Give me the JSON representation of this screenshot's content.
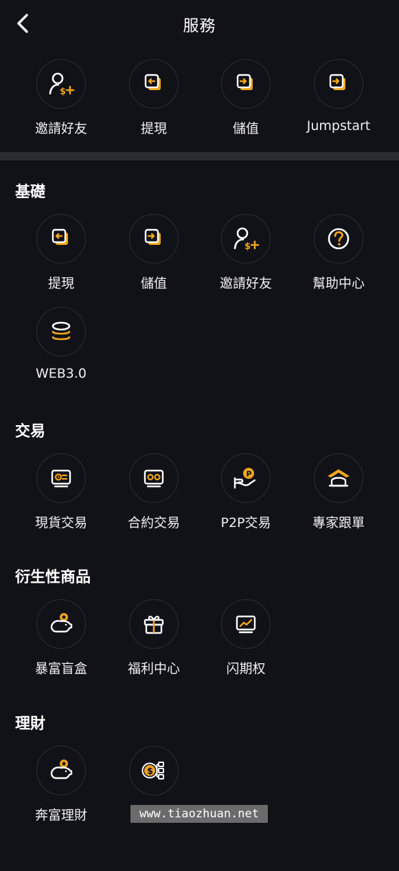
{
  "header": {
    "title": "服務",
    "back_icon": "chevron-left-icon"
  },
  "colors": {
    "background": "#111118",
    "accent": "#f0a51c",
    "divider": "#2b2c31",
    "text": "#ffffff"
  },
  "quick_actions": [
    {
      "label": "邀請好友",
      "icon": "invite-user-icon"
    },
    {
      "label": "提現",
      "icon": "withdraw-icon"
    },
    {
      "label": "儲值",
      "icon": "deposit-icon"
    },
    {
      "label": "Jumpstart",
      "icon": "jumpstart-icon"
    }
  ],
  "sections": [
    {
      "title": "基礎",
      "items": [
        {
          "label": "提現",
          "icon": "withdraw-icon"
        },
        {
          "label": "儲值",
          "icon": "deposit-icon"
        },
        {
          "label": "邀請好友",
          "icon": "invite-user-icon"
        },
        {
          "label": "幫助中心",
          "icon": "help-icon"
        },
        {
          "label": "WEB3.0",
          "icon": "coins-stack-icon"
        }
      ]
    },
    {
      "title": "交易",
      "items": [
        {
          "label": "現貨交易",
          "icon": "spot-trade-icon"
        },
        {
          "label": "合約交易",
          "icon": "contract-trade-icon"
        },
        {
          "label": "P2P交易",
          "icon": "p2p-icon"
        },
        {
          "label": "專家跟單",
          "icon": "copy-trade-icon"
        }
      ]
    },
    {
      "title": "衍生性商品",
      "items": [
        {
          "label": "暴富盲盒",
          "icon": "piggy-bank-icon"
        },
        {
          "label": "福利中心",
          "icon": "gift-icon"
        },
        {
          "label": "闪期权",
          "icon": "chart-monitor-icon"
        }
      ]
    },
    {
      "title": "理財",
      "items": [
        {
          "label": "奔富理財",
          "icon": "piggy-bank-icon"
        },
        {
          "label": "",
          "icon": "dollar-network-icon"
        }
      ]
    }
  ],
  "watermark": "www.tiaozhuan.net"
}
